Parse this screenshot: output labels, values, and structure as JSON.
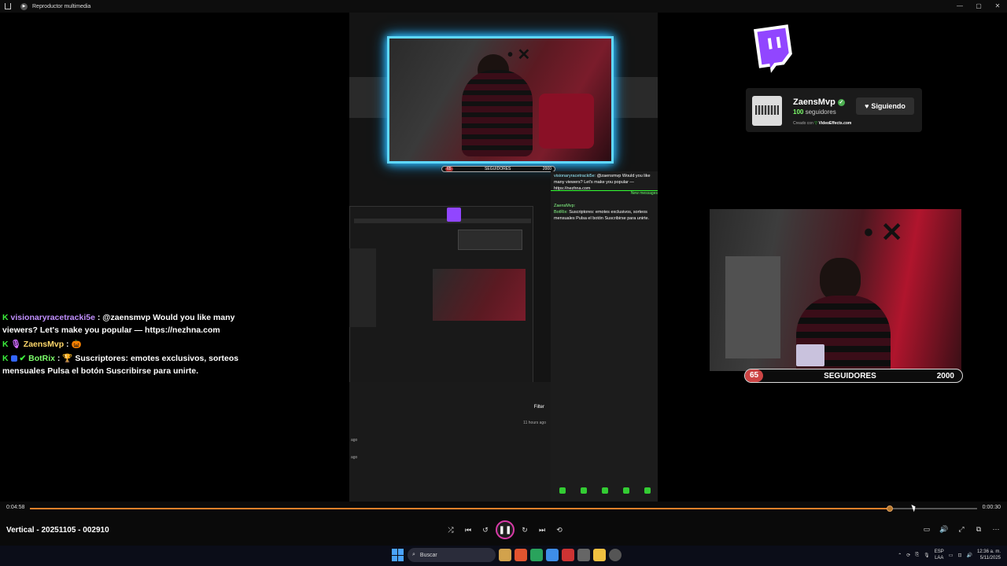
{
  "window": {
    "title": "Reproductor multimedia",
    "controls": [
      "—",
      "▢",
      "✕"
    ]
  },
  "overlay_center": {
    "progress": {
      "current": "65",
      "label": "SEGUIDORES",
      "goal": "2000"
    },
    "chat_lines": [
      {
        "user": "visionaryracetracki5e:",
        "text": "@zaensmvp Would you like many viewers? Let's make you popular — https://nezhna.com"
      },
      {
        "user": "ZaensMvp:",
        "text": ""
      },
      {
        "user": "BotRix:",
        "text": "Suscriptores: emotes exclusivos, sorteos mensuales Pulsa el botón Suscribirse para unirte."
      }
    ],
    "new_messages": "New messages",
    "filter": "Filter",
    "hours_ago": "11 hours ago",
    "ago1": "ago",
    "ago2": "ago"
  },
  "twitch_card": {
    "name": "ZaensMvp",
    "followers_count": "100",
    "followers_label": "seguidores",
    "created_prefix": "Creado con",
    "created_brand": "VideoEffects.com",
    "follow_label": "Siguiendo"
  },
  "followers_goal": {
    "current": "65",
    "label": "SEGUIDORES",
    "goal": "2000"
  },
  "chat": [
    {
      "user": "visionaryracetracki5e",
      "sep": " : ",
      "text": "@zaensmvp Would you like many viewers? Let's make you popular — https://nezhna.com"
    },
    {
      "user": "ZaensMvp",
      "sep": " : ",
      "text": "🎃"
    },
    {
      "user": "BotRix",
      "sep": " : ",
      "text": "🏆 Suscriptores: emotes exclusivos, sorteos mensuales Pulsa el botón Suscribirse para unirte."
    }
  ],
  "player": {
    "elapsed": "0:04:58",
    "duration": "0:00:30",
    "progress_fraction": 0.908,
    "video_title": "Vertical - 20251105 - 002910",
    "buttons": {
      "shuffle": "⤮",
      "prev": "⏮",
      "back10": "↺",
      "pause": "❚❚",
      "fwd30": "↻",
      "next": "⏭",
      "repeat": "⟲"
    },
    "right_buttons": {
      "captions": "▭",
      "volume": "🔊",
      "fullscreen": "⤢",
      "miniplayer": "⧉",
      "more": "⋯"
    }
  },
  "taskbar": {
    "search": "Buscar",
    "lang_top": "ESP",
    "lang_bottom": "LAA",
    "time": "12:36 a. m.",
    "date": "5/11/2025"
  }
}
